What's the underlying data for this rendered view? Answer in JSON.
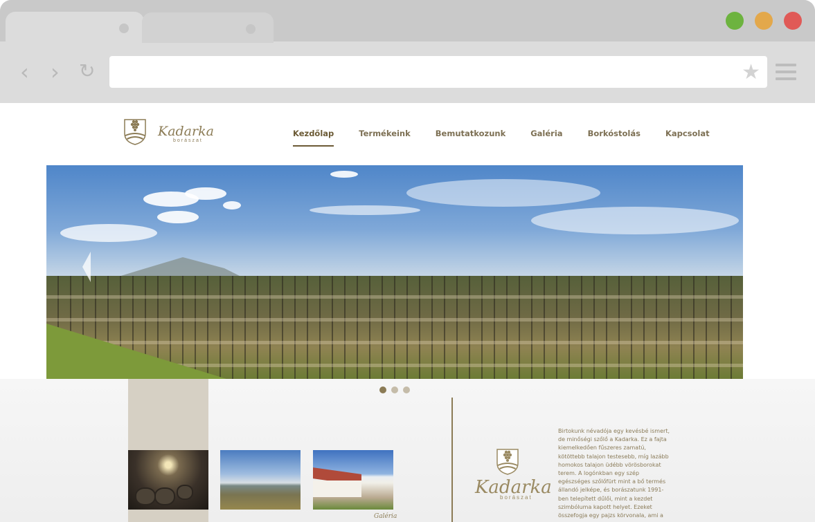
{
  "browser": {
    "controls": {
      "back_icon": "chevron-left-icon",
      "forward_icon": "chevron-right-icon",
      "reload_icon": "reload-icon",
      "star_icon": "star-icon",
      "menu_icon": "hamburger-menu-icon"
    },
    "url": "",
    "window_buttons": {
      "green": "#6db33f",
      "yellow": "#e3a84b",
      "red": "#e05a57"
    }
  },
  "site": {
    "logo": {
      "name": "Kadarka",
      "sub": "borászat"
    },
    "nav": [
      {
        "label": "Kezdőlap",
        "active": true
      },
      {
        "label": "Termékeink",
        "active": false
      },
      {
        "label": "Bemutatkozunk",
        "active": false
      },
      {
        "label": "Galéria",
        "active": false
      },
      {
        "label": "Borkóstolás",
        "active": false
      },
      {
        "label": "Kapcsolat",
        "active": false
      }
    ],
    "slider": {
      "slides": 3,
      "active_index": 0
    },
    "gallery_caption": "Galéria",
    "about_text": "Birtokunk névadója egy kevésbé ismert, de minőségi szőlő a Kadarka. Ez a fajta kiemelkedően fűszeres zamatú, kötöttebb talajon testesebb, míg lazább homokos talajon üdébb vörösborokat terem. A logónkban egy szép egészséges szőlőfürt mint a bő termés állandó jelképe, és borászatunk 1991-ben telepített dűlői, mint a kezdet szimbóluma kapott helyet. Ezeket összefogja egy pajzs körvonala, ami a"
  },
  "colors": {
    "accent": "#8b7b55",
    "nav_text": "#7d7054"
  }
}
